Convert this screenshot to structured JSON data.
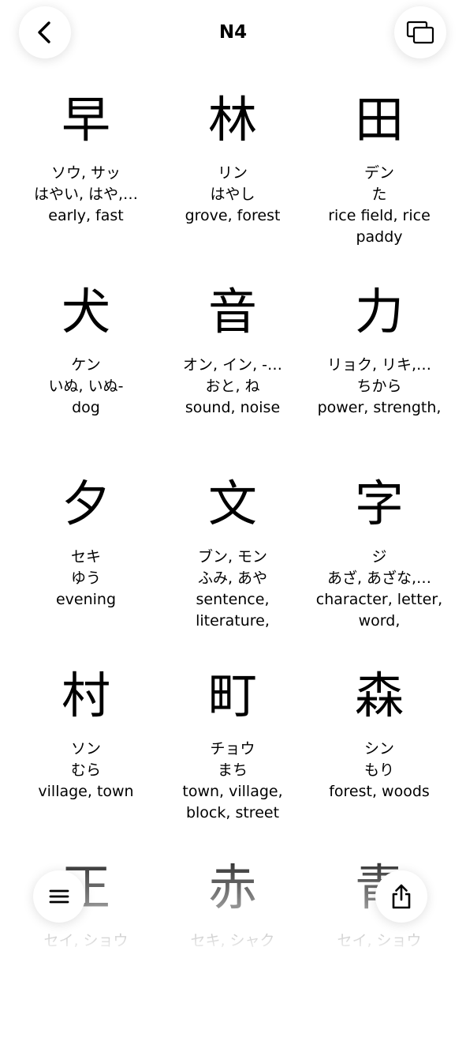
{
  "header": {
    "title": "N4"
  },
  "kanji_rows": [
    [
      {
        "kanji": "早",
        "on": "ソウ, サッ",
        "kun": "はやい, はや,…",
        "meaning": "early, fast"
      },
      {
        "kanji": "林",
        "on": "リン",
        "kun": "はやし",
        "meaning": "grove, forest"
      },
      {
        "kanji": "田",
        "on": "デン",
        "kun": "た",
        "meaning": "rice field, rice paddy"
      }
    ],
    [
      {
        "kanji": "犬",
        "on": "ケン",
        "kun": "いぬ, いぬ-",
        "meaning": "dog"
      },
      {
        "kanji": "音",
        "on": "オン, イン, -…",
        "kun": "おと, ね",
        "meaning": "sound, noise"
      },
      {
        "kanji": "力",
        "on": "リョク, リキ,…",
        "kun": "ちから",
        "meaning": "power, strength,"
      }
    ],
    [
      {
        "kanji": "夕",
        "on": "セキ",
        "kun": "ゆう",
        "meaning": "evening"
      },
      {
        "kanji": "文",
        "on": "ブン, モン",
        "kun": "ふみ, あや",
        "meaning": "sentence, literature,"
      },
      {
        "kanji": "字",
        "on": "ジ",
        "kun": "あざ, あざな,…",
        "meaning": "character, letter, word,"
      }
    ],
    [
      {
        "kanji": "村",
        "on": "ソン",
        "kun": "むら",
        "meaning": "village, town"
      },
      {
        "kanji": "町",
        "on": "チョウ",
        "kun": "まち",
        "meaning": "town, village, block, street"
      },
      {
        "kanji": "森",
        "on": "シン",
        "kun": "もり",
        "meaning": "forest, woods"
      }
    ],
    [
      {
        "kanji": "正",
        "on": "セイ, ショウ",
        "kun": "",
        "meaning": ""
      },
      {
        "kanji": "赤",
        "on": "セキ, シャク",
        "kun": "",
        "meaning": ""
      },
      {
        "kanji": "青",
        "on": "セイ, ショウ",
        "kun": "",
        "meaning": ""
      }
    ]
  ],
  "icons": {
    "back": "chevron-left-icon",
    "cards": "stacked-cards-icon",
    "menu": "menu-icon",
    "share": "share-icon"
  }
}
